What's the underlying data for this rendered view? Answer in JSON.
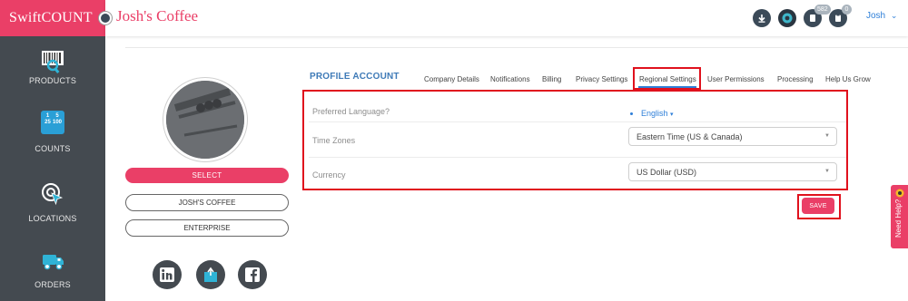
{
  "app": {
    "brand": "SwiftCOUNT",
    "store_name": "Josh's Coffee"
  },
  "topbar": {
    "download_icon": "download-icon",
    "help_icon": "support-icon",
    "notifications_badge": "582",
    "clipboard_badge": "0",
    "user_label": "Josh",
    "user_caret": "⌄"
  },
  "sidebar": {
    "items": [
      {
        "label": "PRODUCTS",
        "icon": "barcode-icon"
      },
      {
        "label": "COUNTS",
        "icon": "counts-icon",
        "tiles": [
          "1",
          "5",
          "25",
          "100"
        ]
      },
      {
        "label": "LOCATIONS",
        "icon": "location-cursor-icon"
      },
      {
        "label": "ORDERS",
        "icon": "truck-icon"
      }
    ]
  },
  "profile": {
    "select_label": "SELECT",
    "company_label": "JOSH'S COFFEE",
    "plan_label": "ENTERPRISE",
    "social": [
      "linkedin-icon",
      "share-icon",
      "facebook-icon"
    ]
  },
  "main": {
    "title": "PROFILE ACCOUNT",
    "tabs": [
      "Company Details",
      "Notifications",
      "Billing",
      "Privacy Settings",
      "Regional Settings",
      "User Permissions",
      "Processing",
      "Help Us Grow"
    ],
    "active_tab": "Regional Settings",
    "settings": {
      "language_label": "Preferred Language?",
      "language_value": "English",
      "timezone_label": "Time Zones",
      "timezone_value": "Eastern Time (US & Canada)",
      "currency_label": "Currency",
      "currency_value": "US Dollar (USD)"
    },
    "save_label": "SAVE"
  },
  "help_tab": {
    "label": "Need Help?"
  },
  "colors": {
    "brand": "#ea3f67",
    "sidebar": "#444a50",
    "accent_blue": "#2e7fd8",
    "highlight_red": "#e0111d"
  }
}
